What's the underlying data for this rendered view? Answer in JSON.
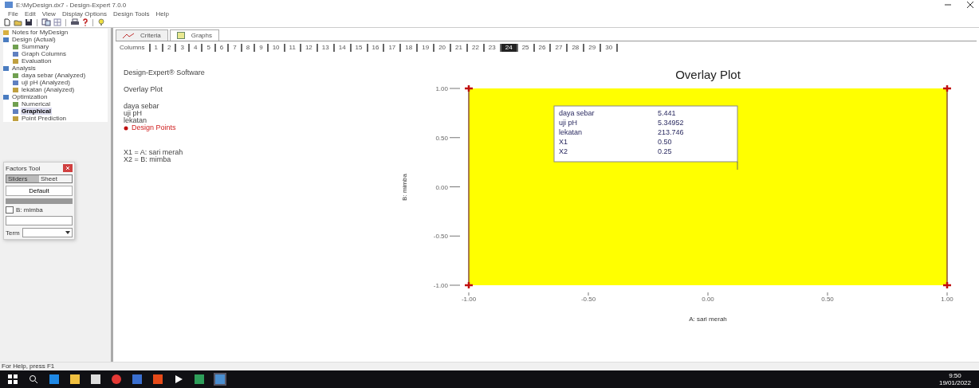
{
  "window": {
    "title": "E:\\MyDesign.dx7 - Design-Expert 7.0.0"
  },
  "menu": [
    "File",
    "Edit",
    "View",
    "Display Options",
    "Design Tools",
    "Help"
  ],
  "tree": [
    {
      "label": "Notes for MyDesign"
    },
    {
      "label": "Design (Actual)",
      "children": [
        {
          "label": "Summary",
          "selected": false
        },
        {
          "label": "Graph Columns",
          "selected": false
        },
        {
          "label": "Evaluation",
          "selected": false
        }
      ]
    },
    {
      "label": "Analysis",
      "children": [
        {
          "label": "daya sebar (Analyzed)",
          "selected": false
        },
        {
          "label": "uji pH (Analyzed)",
          "selected": false
        },
        {
          "label": "lekatan (Analyzed)",
          "selected": false
        }
      ]
    },
    {
      "label": "Optimization",
      "children": [
        {
          "label": "Numerical",
          "selected": false
        },
        {
          "label": "Graphical",
          "selected": true
        },
        {
          "label": "Point Prediction",
          "selected": false
        }
      ]
    }
  ],
  "tabs": [
    {
      "label": "Criteria",
      "selected": false
    },
    {
      "label": "Graphs",
      "selected": true
    }
  ],
  "columns_label": "Columns",
  "columns": [
    {
      "label": "1",
      "selected": false
    },
    {
      "label": "2",
      "selected": false
    },
    {
      "label": "3",
      "selected": false
    },
    {
      "label": "4",
      "selected": false
    },
    {
      "label": "5",
      "selected": false
    },
    {
      "label": "6",
      "selected": false
    },
    {
      "label": "7",
      "selected": false
    },
    {
      "label": "8",
      "selected": false
    },
    {
      "label": "9",
      "selected": false
    },
    {
      "label": "10",
      "selected": false
    },
    {
      "label": "11",
      "selected": false
    },
    {
      "label": "12",
      "selected": false
    },
    {
      "label": "13",
      "selected": false
    },
    {
      "label": "14",
      "selected": false
    },
    {
      "label": "15",
      "selected": false
    },
    {
      "label": "16",
      "selected": false
    },
    {
      "label": "17",
      "selected": false
    },
    {
      "label": "18",
      "selected": false
    },
    {
      "label": "19",
      "selected": false
    },
    {
      "label": "20",
      "selected": false
    },
    {
      "label": "21",
      "selected": false
    },
    {
      "label": "22",
      "selected": false
    },
    {
      "label": "23",
      "selected": false
    },
    {
      "label": "24",
      "selected": true
    },
    {
      "label": "25",
      "selected": false
    },
    {
      "label": "26",
      "selected": false
    },
    {
      "label": "27",
      "selected": false
    },
    {
      "label": "28",
      "selected": false
    },
    {
      "label": "29",
      "selected": false
    },
    {
      "label": "30",
      "selected": false
    }
  ],
  "legend": {
    "software": "Design-Expert® Software",
    "plot": "Overlay Plot",
    "responses": [
      "daya sebar",
      "uji pH",
      "lekatan"
    ],
    "points": "Design Points",
    "factors": [
      "X1 = A: sari merah",
      "X2 = B: mimba"
    ]
  },
  "plot": {
    "title": "Overlay Plot",
    "xlabel": "A: sari merah",
    "ylabel": "B: mimba",
    "xticks": [
      "-1.00",
      "-0.50",
      "0.00",
      "0.50",
      "1.00"
    ],
    "yticks": [
      "1.00",
      "0.50",
      "0.00",
      "-0.50",
      "-1.00"
    ],
    "flag": [
      {
        "name": "daya sebar",
        "value": "5.441"
      },
      {
        "name": "uji pH",
        "value": "5.34952"
      },
      {
        "name": "lekatan",
        "value": "213.746"
      },
      {
        "name": "X1",
        "value": "0.50"
      },
      {
        "name": "X2",
        "value": "0.25"
      }
    ]
  },
  "factors_tool": {
    "title": "Factors Tool",
    "tabs": [
      {
        "label": "Sliders",
        "selected": true
      },
      {
        "label": "Sheet",
        "selected": false
      }
    ],
    "default_button": "Default",
    "factor": "B: mimba",
    "checked": false,
    "term_label": "Term"
  },
  "status_bar": "For Help, press F1",
  "clock": {
    "time": "9:50",
    "date": "19/01/2022"
  }
}
